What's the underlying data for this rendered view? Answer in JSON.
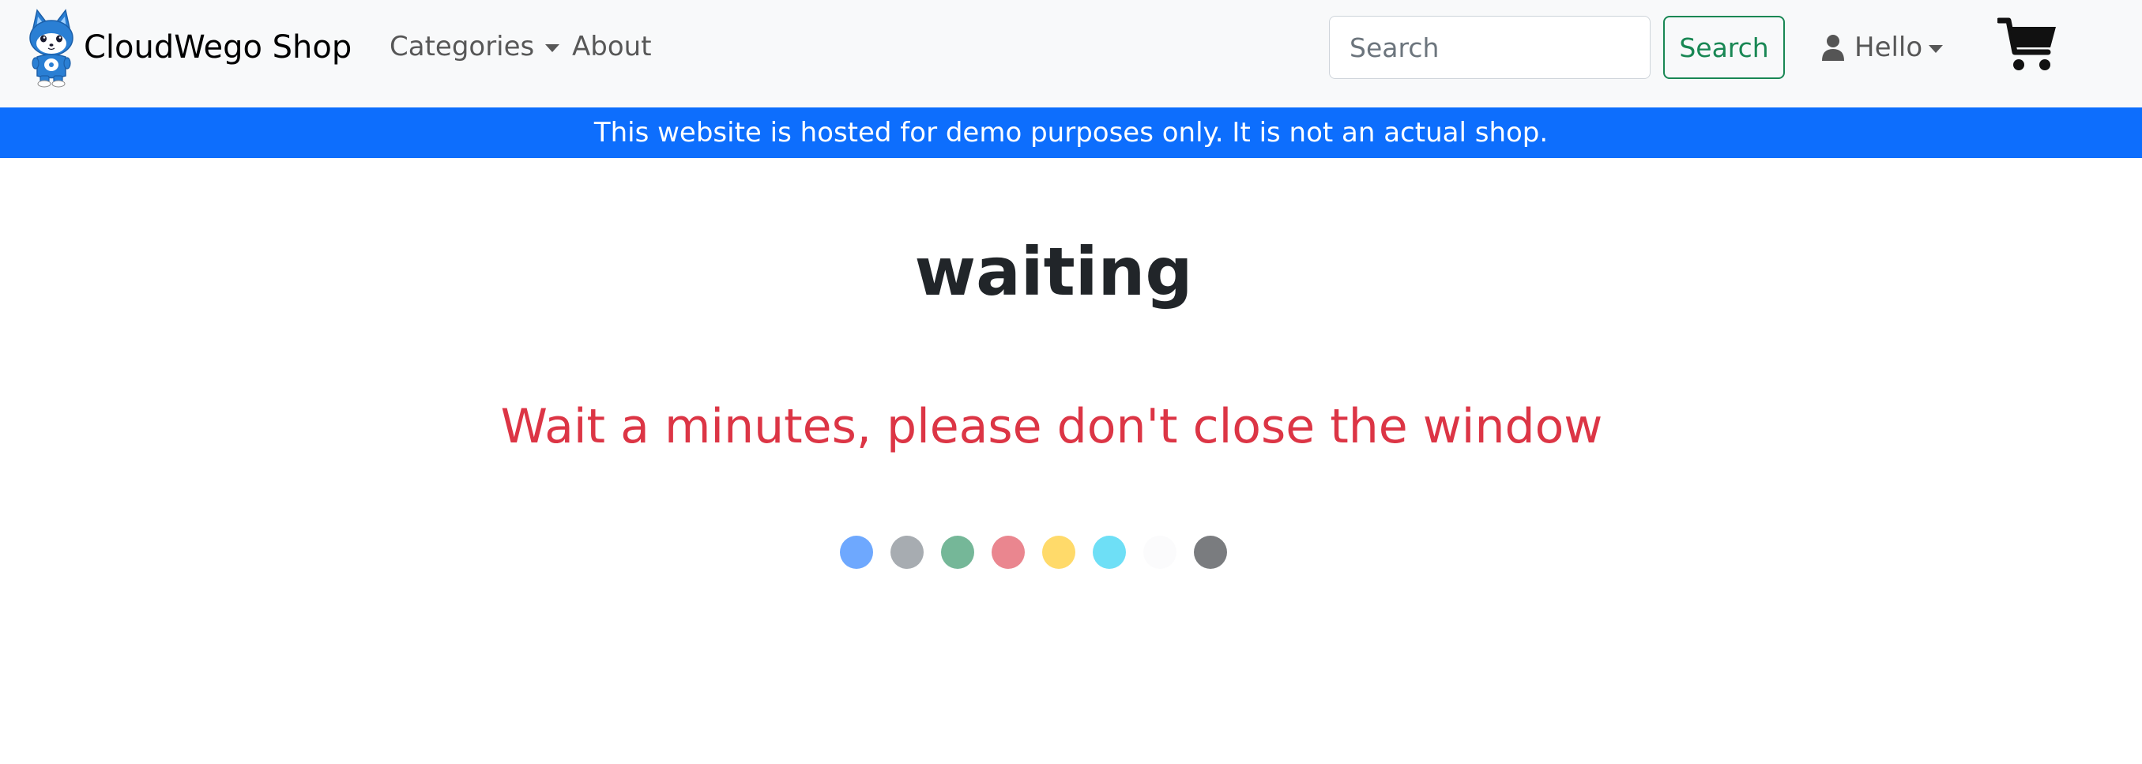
{
  "navbar": {
    "brand": "CloudWego Shop",
    "links": [
      {
        "label": "Categories",
        "dropdown": true
      },
      {
        "label": "About",
        "dropdown": false
      }
    ],
    "search": {
      "placeholder": "Search",
      "value": "",
      "button_label": "Search"
    },
    "user_label": "Hello",
    "cart_icon": "cart-icon"
  },
  "banner": {
    "text": "This website is hosted for demo purposes only. It is not an actual shop."
  },
  "main": {
    "title": "waiting",
    "message": "Wait a minutes, please don't close the window",
    "dots": [
      "#0d6efd",
      "#6c757d",
      "#198754",
      "#dc3545",
      "#ffc107",
      "#0dcaf0",
      "#f8f9fa",
      "#212529"
    ]
  },
  "colors": {
    "navbar_bg": "#f8f9fa",
    "banner_bg": "#0d6efd",
    "message": "#dc3545",
    "search_button": "#198754"
  }
}
